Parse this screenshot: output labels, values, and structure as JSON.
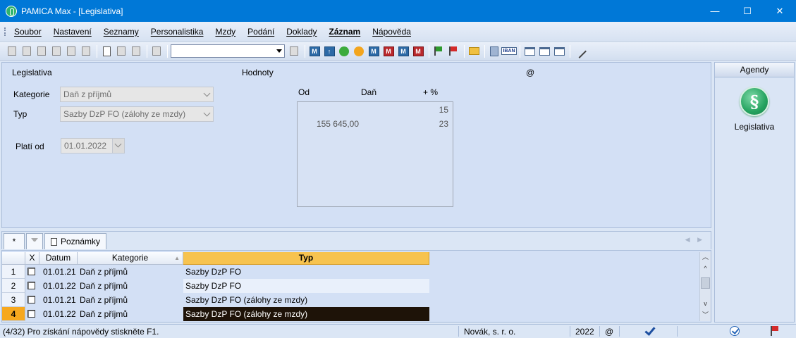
{
  "window": {
    "title": "PAMICA Max - [Legislativa]",
    "minimize": "—",
    "maximize": "☐",
    "close": "✕"
  },
  "menu": [
    "Soubor",
    "Nastavení",
    "Seznamy",
    "Personalistika",
    "Mzdy",
    "Podání",
    "Doklady",
    "Záznam",
    "Nápověda"
  ],
  "toolbar": {
    "combo_value": "",
    "iban": "IBAN"
  },
  "legislativa": {
    "section_title": "Legislativa",
    "kategorie_label": "Kategorie",
    "kategorie_value": "Daň z příjmů",
    "typ_label": "Typ",
    "typ_value": "Sazby DzP FO (zálohy ze mzdy)",
    "plati_od_label": "Platí od",
    "plati_od_value": "01.01.2022"
  },
  "hodnoty": {
    "section_title": "Hodnoty",
    "at_sign": "@",
    "col_od": "Od",
    "col_dan": "Daň",
    "col_pct": "+ %",
    "rows": [
      {
        "od": "",
        "pct": "15"
      },
      {
        "od": "155 645,00",
        "pct": "23"
      }
    ]
  },
  "agendy": {
    "header": "Agendy",
    "item_label": "Legislativa",
    "icon_symbol": "§"
  },
  "tabs": {
    "star": "*",
    "poznamky": "Poznámky"
  },
  "grid": {
    "headers": {
      "x": "X",
      "datum": "Datum",
      "kategorie": "Kategorie",
      "typ": "Typ"
    },
    "rows": [
      {
        "num": "1",
        "datum": "01.01.21",
        "kategorie": "Daň z příjmů",
        "typ": "Sazby DzP FO"
      },
      {
        "num": "2",
        "datum": "01.01.22",
        "kategorie": "Daň z příjmů",
        "typ": "Sazby DzP FO"
      },
      {
        "num": "3",
        "datum": "01.01.21",
        "kategorie": "Daň z příjmů",
        "typ": "Sazby DzP FO (zálohy ze mzdy)"
      },
      {
        "num": "4",
        "datum": "01.01.22",
        "kategorie": "Daň z příjmů",
        "typ": "Sazby DzP FO (zálohy ze mzdy)"
      }
    ],
    "current_row": 4
  },
  "status": {
    "hint": "(4/32) Pro získání nápovědy stiskněte F1.",
    "company": "Novák, s. r. o.",
    "year": "2022",
    "at_sign": "@"
  },
  "colors": {
    "titlebar": "#0078d7",
    "selected_header": "#f7c34f",
    "highlight_row": "#1e1308",
    "panel": "#d3e0f5"
  }
}
